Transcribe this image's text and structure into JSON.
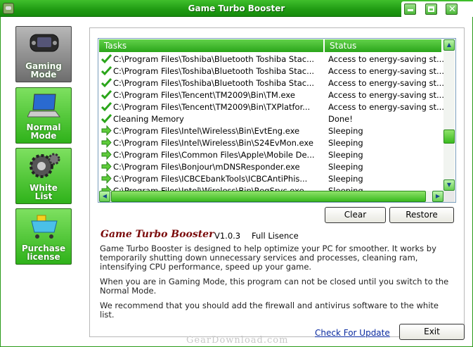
{
  "window": {
    "title": "Game Turbo Booster"
  },
  "sidebar": {
    "items": [
      {
        "label_line1": "Gaming",
        "label_line2": "Mode",
        "icon": "gamepad-icon"
      },
      {
        "label_line1": "Normal",
        "label_line2": "Mode",
        "icon": "laptop-icon"
      },
      {
        "label_line1": "White",
        "label_line2": "List",
        "icon": "gear-icon"
      },
      {
        "label_line1": "Purchase",
        "label_line2": "license",
        "icon": "cart-icon"
      }
    ]
  },
  "table": {
    "columns": [
      "Tasks",
      "Status"
    ],
    "rows": [
      {
        "task": "C:\\Program Files\\Toshiba\\Bluetooth Toshiba Stac...",
        "status": "Access to energy-saving st...",
        "state": "done"
      },
      {
        "task": "C:\\Program Files\\Toshiba\\Bluetooth Toshiba Stac...",
        "status": "Access to energy-saving st...",
        "state": "done"
      },
      {
        "task": "C:\\Program Files\\Toshiba\\Bluetooth Toshiba Stac...",
        "status": "Access to energy-saving st...",
        "state": "done"
      },
      {
        "task": "C:\\Program Files\\Tencent\\TM2009\\Bin\\TM.exe",
        "status": "Access to energy-saving st...",
        "state": "done"
      },
      {
        "task": "C:\\Program Files\\Tencent\\TM2009\\Bin\\TXPlatfor...",
        "status": "Access to energy-saving st...",
        "state": "done"
      },
      {
        "task": "Cleaning Memory",
        "status": "Done!",
        "state": "done"
      },
      {
        "task": "C:\\Program Files\\Intel\\Wireless\\Bin\\EvtEng.exe",
        "status": "Sleeping",
        "state": "arrow"
      },
      {
        "task": "C:\\Program Files\\Intel\\Wireless\\Bin\\S24EvMon.exe",
        "status": "Sleeping",
        "state": "arrow"
      },
      {
        "task": "C:\\Program Files\\Common Files\\Apple\\Mobile De...",
        "status": "Sleeping",
        "state": "arrow"
      },
      {
        "task": "C:\\Program Files\\Bonjour\\mDNSResponder.exe",
        "status": "Sleeping",
        "state": "arrow"
      },
      {
        "task": "C:\\Program Files\\ICBCEbankTools\\ICBCAntiPhis...",
        "status": "Sleeping",
        "state": "arrow"
      },
      {
        "task": "C:\\Program Files\\Intel\\Wireless\\Bin\\RegSrvc.exe",
        "status": "Sleeping",
        "state": "arrow"
      }
    ]
  },
  "buttons": {
    "clear": "Clear",
    "restore": "Restore",
    "exit": "Exit"
  },
  "info": {
    "app_name": "Game Turbo Booster",
    "version": "V1.0.3",
    "license": "Full Lisence",
    "paragraph1": "Game Turbo Booster is designed to help optimize your PC for smoother. It works by temporarily shutting down unnecessary services and processes, cleaning ram, intensifying CPU performance, speed up your game.",
    "paragraph2": "When you are in Gaming Mode, this program can not be closed until you switch to the Normal Mode.",
    "paragraph3": "We recommend that you should add the firewall and antivirus software to the white list."
  },
  "links": {
    "check_update": "Check For Update"
  },
  "watermark": "GearDownload.com",
  "colors": {
    "accent": "#2fb21a",
    "title_text": "#7a0a0a",
    "link": "#0a2aa0"
  }
}
